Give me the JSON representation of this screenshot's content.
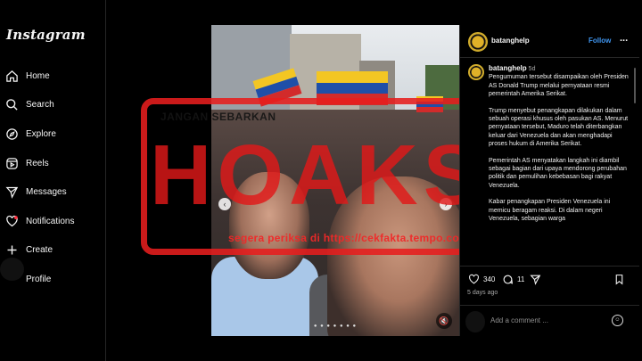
{
  "app": {
    "logo": "Instagram"
  },
  "nav": [
    {
      "label": "Home",
      "icon": "home-icon"
    },
    {
      "label": "Search",
      "icon": "search-icon"
    },
    {
      "label": "Explore",
      "icon": "compass-icon"
    },
    {
      "label": "Reels",
      "icon": "reels-icon"
    },
    {
      "label": "Messages",
      "icon": "send-icon"
    },
    {
      "label": "Notifications",
      "icon": "heart-icon"
    },
    {
      "label": "Create",
      "icon": "plus-icon"
    },
    {
      "label": "Profile",
      "icon": "avatar-icon"
    }
  ],
  "stamp": {
    "top_text": "JANGAN SEBARKAN",
    "word": "HOAKS",
    "bottom_text": "segera periksa di https://cekfakta.tempo.co",
    "color": "#e11919"
  },
  "post": {
    "username": "batanghelp",
    "follow_label": "Follow",
    "more": "...",
    "caption_user": "batanghelp",
    "caption_time": "5d",
    "caption": [
      "Pengumuman tersebut disampaikan oleh Presiden AS Donald Trump melalui pernyataan resmi pemerintah Amerika Serikat.",
      "Trump menyebut penangkapan dilakukan dalam sebuah operasi khusus oleh pasukan AS. Menurut pernyataan tersebut, Maduro telah diterbangkan keluar dari Venezuela dan akan menghadapi proses hukum di Amerika Serikat.",
      "Pemerintah AS menyatakan langkah ini diambil sebagai bagian dari upaya mendorong perubahan politik dan pemulihan kebebasan bagi rakyat Venezuela.",
      "Kabar penangkapan Presiden Venezuela ini memicu beragam reaksi. Di dalam negeri Venezuela, sebagian warga"
    ],
    "likes": "340",
    "comments": "11",
    "posted_ago": "5 days ago",
    "comment_placeholder": "Add a comment ...",
    "accent": "#4096f0"
  }
}
